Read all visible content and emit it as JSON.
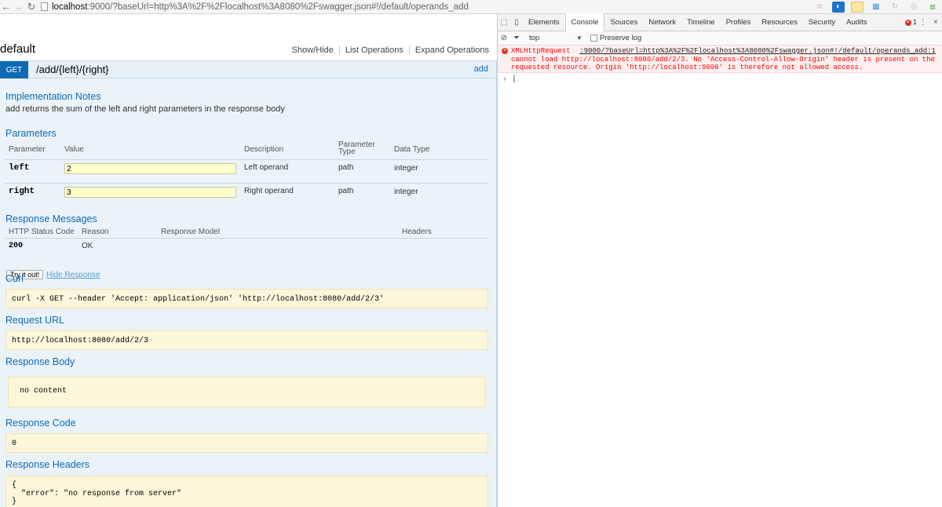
{
  "browser": {
    "url_host": "localhost",
    "url_path": ":9000/?baseUrl=http%3A%2F%2Flocalhost%3A8080%2Fswagger.json#!/default/operands_add"
  },
  "swagger": {
    "resource_name": "default",
    "resource_links": [
      "Show/Hide",
      "List Operations",
      "Expand Operations"
    ],
    "operation": {
      "method": "GET",
      "path": "/add/{left}/{right}",
      "nickname": "add"
    },
    "implementation_notes_title": "Implementation Notes",
    "implementation_notes": "add returns the sum of the left and right parameters in the response body",
    "parameters_title": "Parameters",
    "param_headers": {
      "parameter": "Parameter",
      "value": "Value",
      "description": "Description",
      "parameter_type": "Parameter Type",
      "data_type": "Data Type"
    },
    "params": [
      {
        "name": "left",
        "value": "2",
        "description": "Left operand",
        "type": "path",
        "data_type": "integer"
      },
      {
        "name": "right",
        "value": "3",
        "description": "Right operand",
        "type": "path",
        "data_type": "integer"
      }
    ],
    "response_messages_title": "Response Messages",
    "resp_headers": {
      "status": "HTTP Status Code",
      "reason": "Reason",
      "model": "Response Model",
      "headers": "Headers"
    },
    "resp_row": {
      "status": "200",
      "reason": "OK"
    },
    "try_button": "Try it out!",
    "hide_response": "Hide Response",
    "curl_title": "Curl",
    "curl": "curl -X GET --header 'Accept: application/json' 'http://localhost:8080/add/2/3'",
    "request_url_title": "Request URL",
    "request_url": "http://localhost:8080/add/2/3",
    "response_body_title": "Response Body",
    "response_body": "no content",
    "response_code_title": "Response Code",
    "response_code": "0",
    "response_headers_title": "Response Headers",
    "response_headers": "{\n  \"error\": \"no response from server\"\n}"
  },
  "devtools": {
    "tabs": [
      "Elements",
      "Console",
      "Sources",
      "Network",
      "Timeline",
      "Profiles",
      "Resources",
      "Security",
      "Audits"
    ],
    "active_tab": "Console",
    "error_count": "1",
    "context": "top",
    "preserve_log": "Preserve log",
    "error_source": "XMLHttpRequest",
    "error_link": ":9000/?baseUrl=http%3A%2F%2Flocalhost%3A8080%2Fswagger.json#!/default/operands_add:1",
    "error_line1": "cannot load http://localhost:8080/add/2/3. No 'Access-Control-Allow-Origin' header is present on the",
    "error_line2": "requested resource. Origin 'http://localhost:9000' is therefore not allowed access.",
    "prompt": "›"
  },
  "colors": {
    "accent": "#0f6ab4",
    "op_bg": "#ebf3f9",
    "code_bg": "#fcf6db",
    "error_text": "#ff0000"
  }
}
